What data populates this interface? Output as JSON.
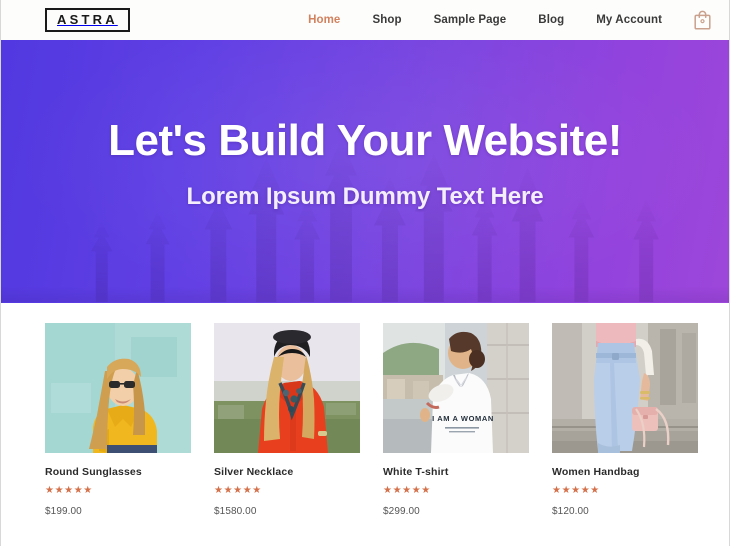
{
  "header": {
    "logo": "ASTRA",
    "nav": [
      {
        "label": "Home",
        "active": true
      },
      {
        "label": "Shop",
        "active": false
      },
      {
        "label": "Sample Page",
        "active": false
      },
      {
        "label": "Blog",
        "active": false
      },
      {
        "label": "My Account",
        "active": false
      }
    ],
    "cart": {
      "icon": "shopping-bag-icon",
      "count": "0",
      "color": "#c9a18c"
    }
  },
  "hero": {
    "title": "Let's Build Your Website!",
    "subtitle": "Lorem Ipsum Dummy Text Here",
    "gradient_from": "#5138e0",
    "gradient_to": "#9d46da",
    "background_image": "forest-silhouette"
  },
  "products": [
    {
      "title": "Round Sunglasses",
      "price": "$199.00",
      "stars": "★★★★★",
      "rating": 5,
      "image_alt": "blonde-woman-sunglasses-yellow-shirt"
    },
    {
      "title": "Silver Necklace",
      "price": "$1580.00",
      "stars": "★★★★★",
      "rating": 5,
      "image_alt": "woman-black-cap-red-sweater-necklace"
    },
    {
      "title": "White T-shirt",
      "price": "$299.00",
      "stars": "★★★★★",
      "rating": 5,
      "image_alt": "woman-back-white-tshirt-i-am-a-woman"
    },
    {
      "title": "Women Handbag",
      "price": "$120.00",
      "stars": "★★★★★",
      "rating": 5,
      "image_alt": "woman-blue-jeans-pink-handbag"
    }
  ],
  "theme": {
    "accent": "#d2825f",
    "star_color": "#d4714a",
    "text_dark": "#2b2b2b"
  }
}
